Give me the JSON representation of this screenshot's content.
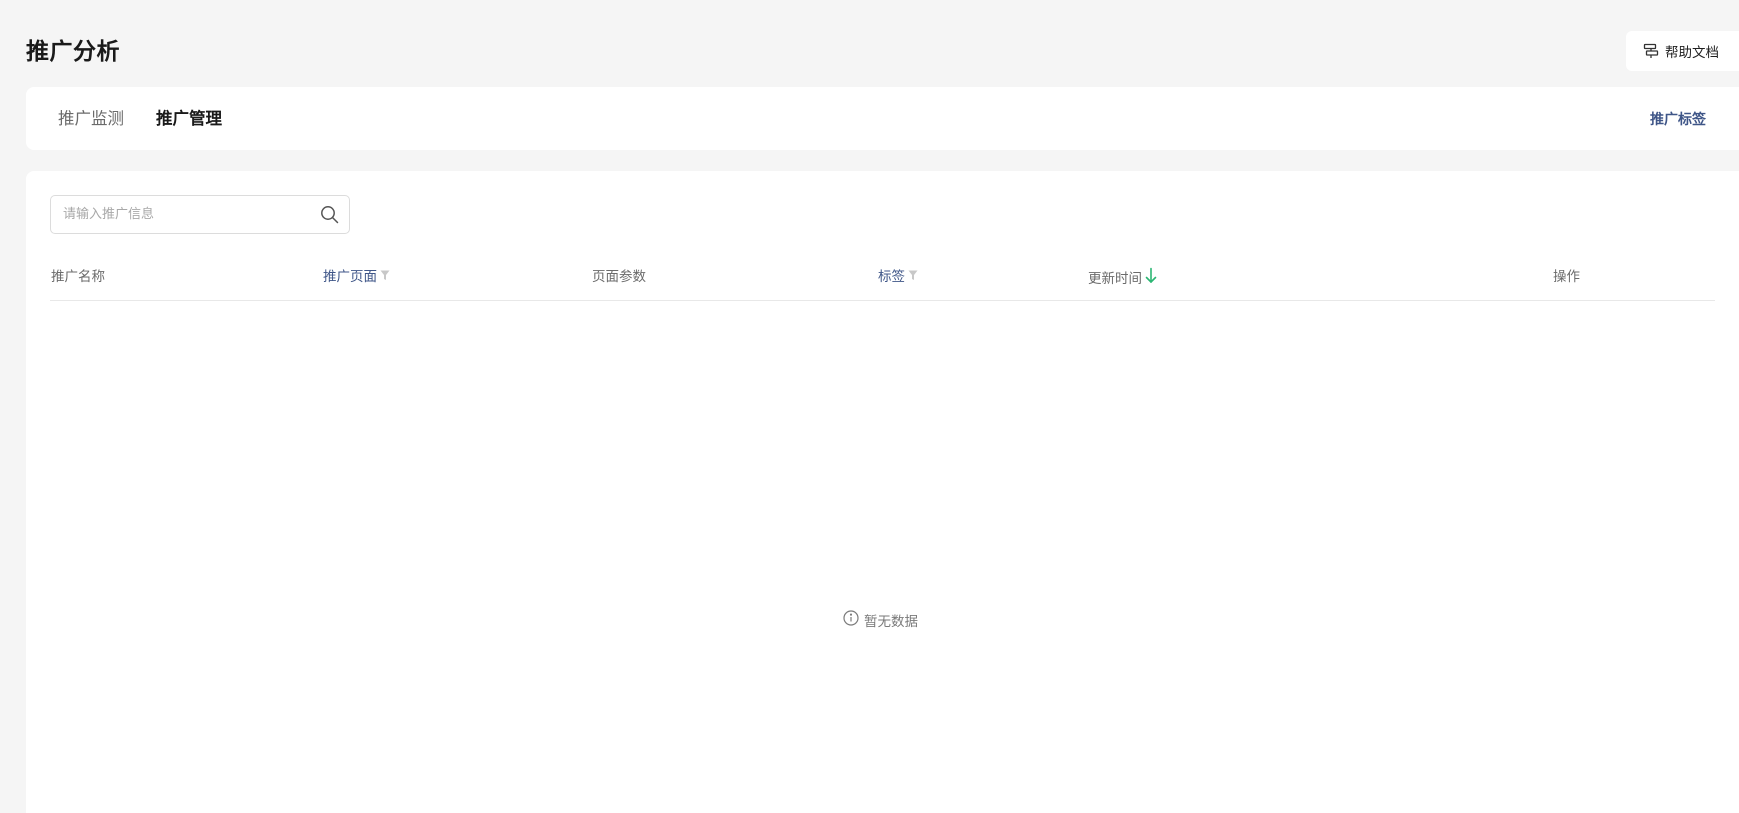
{
  "header": {
    "title": "推广分析",
    "help_label": "帮助文档"
  },
  "tabs": [
    {
      "label": "推广监测",
      "active": false
    },
    {
      "label": "推广管理",
      "active": true
    }
  ],
  "tabs_right_link": "推广标签",
  "search": {
    "placeholder": "请输入推广信息",
    "value": ""
  },
  "table": {
    "columns": [
      {
        "label": "推广名称",
        "filter": false,
        "sort": null
      },
      {
        "label": "推广页面",
        "filter": true,
        "sort": null
      },
      {
        "label": "页面参数",
        "filter": false,
        "sort": null
      },
      {
        "label": "标签",
        "filter": true,
        "sort": null
      },
      {
        "label": "更新时间",
        "filter": false,
        "sort": "desc"
      },
      {
        "label": "操作",
        "filter": false,
        "sort": null
      }
    ],
    "rows": [],
    "empty_text": "暂无数据"
  },
  "colors": {
    "link": "#3f5688",
    "sort_active": "#2bb673",
    "background": "#f5f5f5"
  },
  "icons": {
    "help": "signpost-icon",
    "search": "search-icon",
    "filter": "filter-icon",
    "sort": "arrow-down-icon",
    "empty": "info-icon"
  }
}
